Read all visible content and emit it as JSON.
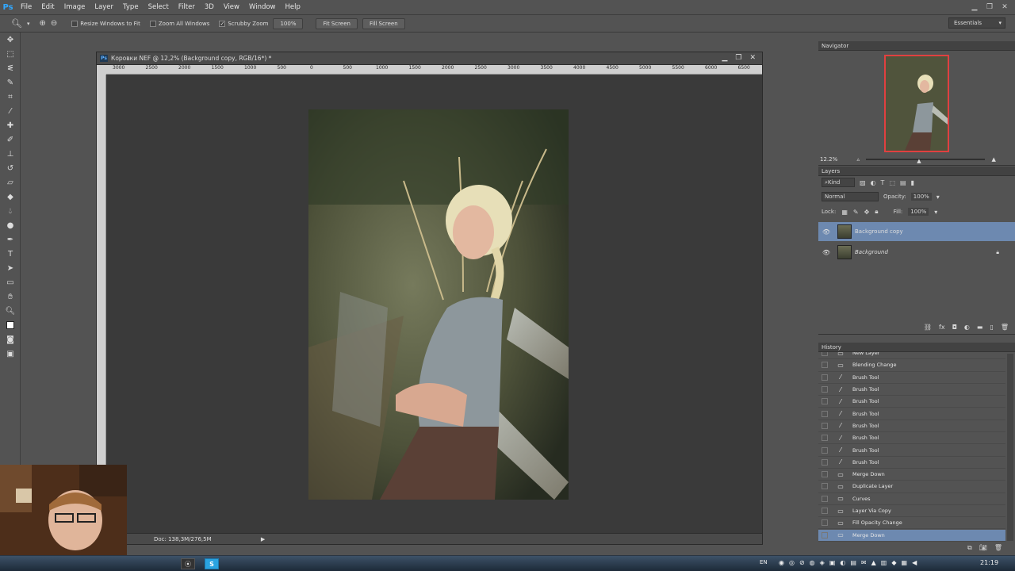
{
  "menubar": {
    "logo": "Ps",
    "items": [
      "File",
      "Edit",
      "Image",
      "Layer",
      "Type",
      "Select",
      "Filter",
      "3D",
      "View",
      "Window",
      "Help"
    ]
  },
  "options": {
    "resize_windows": "Resize Windows to Fit",
    "zoom_all": "Zoom All Windows",
    "scrubby": "Scrubby Zoom",
    "zoom_value": "100%",
    "fit_screen": "Fit Screen",
    "fill_screen": "Fill Screen",
    "workspace": "Essentials"
  },
  "document": {
    "title": "Коровки NEF @ 12,2% (Background copy, RGB/16*) *",
    "ruler_ticks": [
      "3000",
      "2500",
      "2000",
      "1500",
      "1000",
      "500",
      "0",
      "500",
      "1000",
      "1500",
      "2000",
      "2500",
      "3000",
      "3500",
      "4000",
      "4500",
      "5000",
      "5500",
      "6000",
      "6500"
    ],
    "status": "Doc: 138,3M/276,5M"
  },
  "navigator": {
    "tab": "Navigator",
    "zoom": "12.2%"
  },
  "layers": {
    "tab": "Layers",
    "filter": "Kind",
    "blend_mode": "Normal",
    "opacity_label": "Opacity:",
    "opacity": "100%",
    "lock_label": "Lock:",
    "fill_label": "Fill:",
    "fill": "100%",
    "items": [
      {
        "name": "Background copy",
        "selected": true,
        "locked": false
      },
      {
        "name": "Background",
        "selected": false,
        "locked": true
      }
    ]
  },
  "history": {
    "tab": "History",
    "items": [
      {
        "label": "New Layer",
        "icon": "doc-icon"
      },
      {
        "label": "Blending Change",
        "icon": "doc-icon"
      },
      {
        "label": "Brush Tool",
        "icon": "brush-icon"
      },
      {
        "label": "Brush Tool",
        "icon": "brush-icon"
      },
      {
        "label": "Brush Tool",
        "icon": "brush-icon"
      },
      {
        "label": "Brush Tool",
        "icon": "brush-icon"
      },
      {
        "label": "Brush Tool",
        "icon": "brush-icon"
      },
      {
        "label": "Brush Tool",
        "icon": "brush-icon"
      },
      {
        "label": "Brush Tool",
        "icon": "brush-icon"
      },
      {
        "label": "Brush Tool",
        "icon": "brush-icon"
      },
      {
        "label": "Merge Down",
        "icon": "doc-icon"
      },
      {
        "label": "Duplicate Layer",
        "icon": "doc-icon"
      },
      {
        "label": "Curves",
        "icon": "doc-icon"
      },
      {
        "label": "Layer Via Copy",
        "icon": "doc-icon"
      },
      {
        "label": "Fill Opacity Change",
        "icon": "doc-icon"
      },
      {
        "label": "Merge Down",
        "icon": "doc-icon"
      }
    ]
  },
  "taskbar": {
    "lang": "EN",
    "clock": "21:19"
  },
  "colors": {
    "selection": "#6d89b0",
    "panel": "#535353",
    "canvas": "#3a3a3a"
  }
}
